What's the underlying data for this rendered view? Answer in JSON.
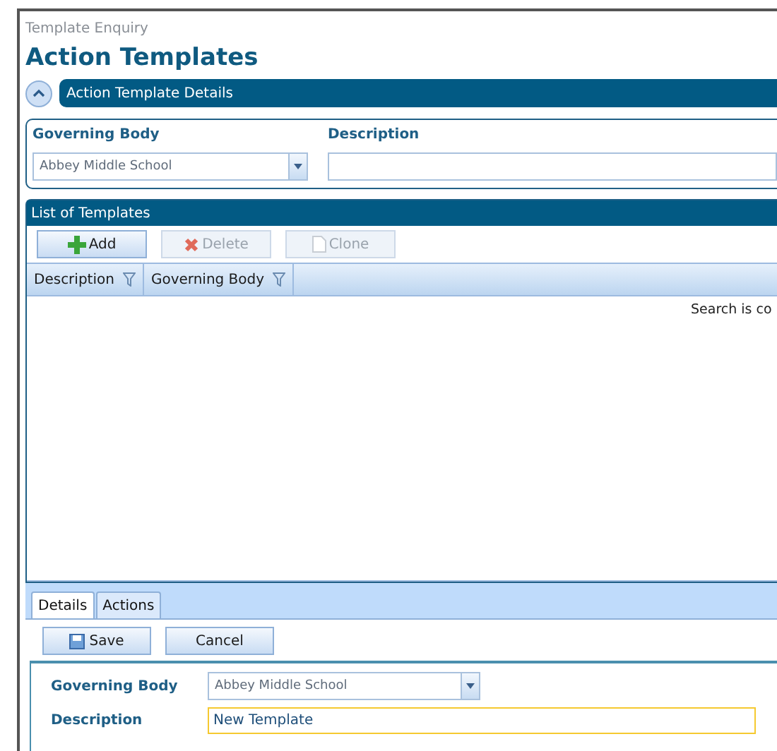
{
  "breadcrumb": "Template Enquiry",
  "title": "Action Templates",
  "details_section": {
    "title": "Action Template Details",
    "expanded": true
  },
  "filters": [
    {
      "kind": "combo",
      "label": "Governing Body",
      "value": "Abbey Middle School"
    },
    {
      "kind": "text",
      "label": "Description"
    }
  ],
  "list": {
    "title": "List of Templates",
    "toolbar": [
      {
        "label": "Add",
        "disabled": false
      },
      {
        "label": "Delete",
        "disabled": true
      },
      {
        "label": "Clone",
        "disabled": true
      }
    ],
    "columns": [
      "Description",
      "Governing Body"
    ],
    "message": "Search is co"
  },
  "tabs": [
    {
      "label": "Details",
      "selected": true
    },
    {
      "label": "Actions",
      "selected": false
    }
  ],
  "actions": [
    {
      "label": "Save"
    },
    {
      "label": "Cancel"
    }
  ],
  "form": [
    {
      "kind": "combo",
      "label": "Governing Body",
      "value": "Abbey Middle School"
    },
    {
      "kind": "text",
      "label": "Description",
      "value": "New Template",
      "focused": true
    }
  ]
}
